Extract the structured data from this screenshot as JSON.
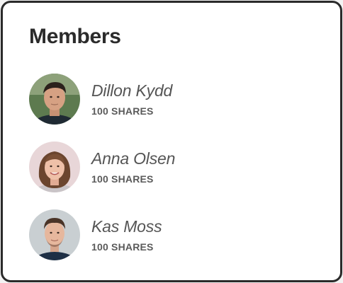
{
  "card": {
    "title": "Members"
  },
  "members": [
    {
      "name": "Dillon Kydd",
      "shares": "100 SHARES",
      "avatar_icon": "avatar-photo-man-dark-hair"
    },
    {
      "name": "Anna Olsen",
      "shares": "100 SHARES",
      "avatar_icon": "avatar-photo-woman-brown-hair"
    },
    {
      "name": "Kas Moss",
      "shares": "100 SHARES",
      "avatar_icon": "avatar-photo-man-short-hair"
    }
  ],
  "colors": {
    "border": "#2a2a2a",
    "title": "#2b2b2b",
    "name": "#555555",
    "shares": "#5a5a5a"
  }
}
